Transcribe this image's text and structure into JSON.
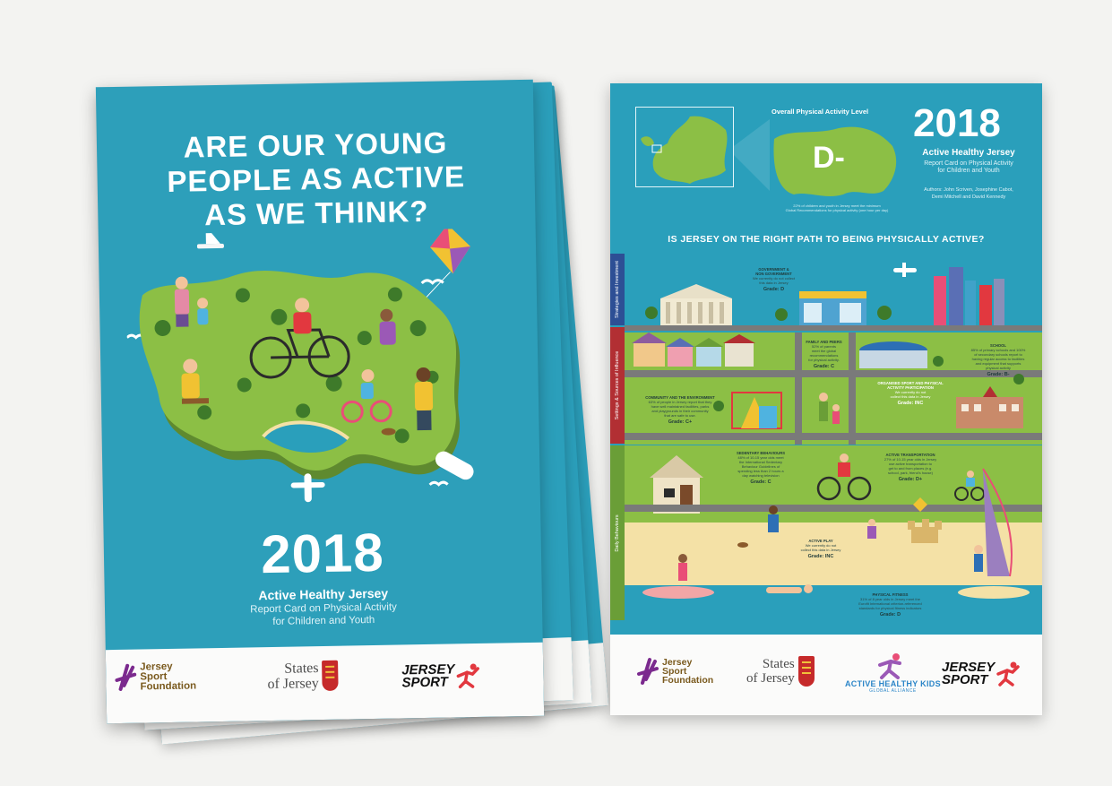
{
  "cover": {
    "title_lines": [
      "ARE OUR YOUNG",
      "PEOPLE AS ACTIVE",
      "AS WE THINK?"
    ],
    "year": "2018",
    "subtitle": "Active Healthy Jersey",
    "subtitle2_line1": "Report Card on Physical Activity",
    "subtitle2_line2": "for Children and Youth"
  },
  "logos": {
    "jsf_line1": "Jersey",
    "jsf_line2": "Sport",
    "jsf_line3": "Foundation",
    "states_line1": "States",
    "states_line2": "of Jersey",
    "jsport_line1": "JERSEY",
    "jsport_line2": "SPORT",
    "ahk": "ACTIVE HEALTHY KIDS",
    "ahk_sub": "GLOBAL ALLIANCE"
  },
  "poster": {
    "level_label": "Overall Physical Activity Level",
    "overall_grade": "D-",
    "note_line1": "22% of children and youth in Jersey meet the minimum",
    "note_line2": "Global Recommendations for physical activity (one hour per day)",
    "year": "2018",
    "title": "Active Healthy Jersey",
    "subtitle_line1": "Report Card on Physical Activity",
    "subtitle_line2": "for Children and Youth",
    "authors_line1": "Authors: John Scriven, Josephine Cabot,",
    "authors_line2": "Demi Mitchell and David Kennedy",
    "question": "IS JERSEY ON THE RIGHT PATH TO BEING PHYSICALLY ACTIVE?",
    "bands": [
      "Strategies and Investment",
      "Settings & Sources of Influence",
      "Daily Behaviours"
    ],
    "sections": {
      "gov": {
        "h1": "GOVERNMENT &",
        "h2": "NON GOVERNMENT",
        "b1": "We currently do not collect",
        "b2": "this data in Jersey",
        "grade": "Grade: D"
      },
      "community": {
        "h": "COMMUNITY AND THE ENVIRONMENT",
        "b1": "63% of people in Jersey report that they",
        "b2": "have well maintained facilities, parks",
        "b3": "and playgrounds in their community",
        "b4": "that are safe to use.",
        "grade": "Grade: C+"
      },
      "family": {
        "h": "FAMILY AND PEERS",
        "b1": "52% of parents",
        "b2": "meet the global",
        "b3": "recommendations",
        "b4": "for physical activity.",
        "grade": "Grade: C"
      },
      "organised": {
        "h1": "ORGANISED SPORT AND PHYSICAL",
        "h2": "ACTIVITY PARTICIPATION",
        "b1": "We currently do not",
        "b2": "collect this data in Jersey",
        "grade": "Grade: INC"
      },
      "school": {
        "h": "SCHOOL",
        "b1": "85% of primary schools and 100%",
        "b2": "of secondary schools report to",
        "b3": "having regular access to facilities",
        "b4": "and equipment that supports",
        "b5": "physical activity",
        "grade": "Grade: B-"
      },
      "sedentary": {
        "h": "SEDENTARY BEHAVIOURS",
        "b1": "48% of 10-15 year olds meet",
        "b2": "the International Sedentary",
        "b3": "Behaviour Guidelines of",
        "b4": "spending less than 2 hours a",
        "b5": "day watching television",
        "grade": "Grade: C"
      },
      "transport": {
        "h": "ACTIVE TRANSPORTATION",
        "b1": "27% of 10-15 year olds in Jersey",
        "b2": "use active transportation to",
        "b3": "get to and from places (e.g.",
        "b4": "school, park, friend's house)",
        "grade": "Grade: D+"
      },
      "play": {
        "h": "ACTIVE PLAY",
        "b1": "We currently do not",
        "b2": "collect this data in Jersey",
        "grade": "Grade: INC"
      },
      "fitness": {
        "h": "PHYSICAL FITNESS",
        "b1": "31% of 8 year olds in Jersey meet the",
        "b2": "Eurofit International criterion-referenced",
        "b3": "standards for physical fitness indicators",
        "grade": "Grade: D"
      }
    }
  },
  "colors": {
    "cover_bg": "#2d9fba",
    "island_green": "#8cbf45",
    "sea": "#2a9fbb",
    "footer_bg": "#fbfbfa",
    "band_blue": "#2d4f95",
    "band_red": "#b22f33",
    "band_green": "#6a9e37"
  }
}
